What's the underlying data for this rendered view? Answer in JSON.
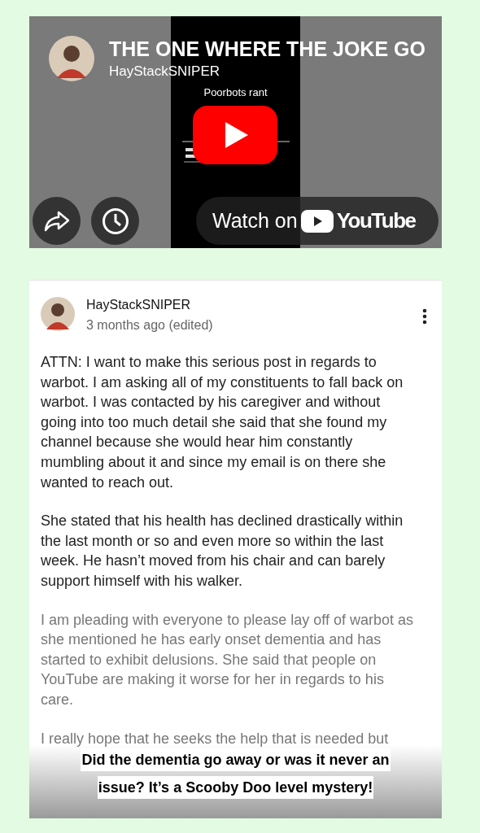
{
  "video": {
    "title": "THE ONE WHERE THE JOKE GO",
    "channel": "HayStackSNIPER",
    "thumbnail_caption": "Poorbots rant",
    "watch_on": "Watch on",
    "brand": "YouTube"
  },
  "post": {
    "author": "HayStackSNIPER",
    "time": "3 months ago (edited)",
    "paragraphs": [
      {
        "text": "ATTN: I want to make this serious post in regards to warbot. I am asking all of my constituents to fall back on warbot. I was contacted by his caregiver and without going into too much detail she said that she found my channel because she would hear him constantly mumbling about it and since my email is on there she wanted to reach out.",
        "dimmed": false
      },
      {
        "text": "She stated that his health has declined drastically within the last month or so and even more so within the last week. He hasn’t moved from his chair and can barely support himself with his walker.",
        "dimmed": false
      },
      {
        "text": "I am pleading with everyone to please lay off of warbot as she mentioned he has early onset dementia and has started to exhibit delusions.  She said that people on YouTube are making it worse for her in regards to his care.",
        "dimmed": true
      },
      {
        "text": "I really hope that he seeks the help that is needed but",
        "dimmed": true
      }
    ]
  },
  "caption": [
    "Did the dementia go away or was it never an",
    "issue? It’s a Scooby Doo level mystery!"
  ]
}
